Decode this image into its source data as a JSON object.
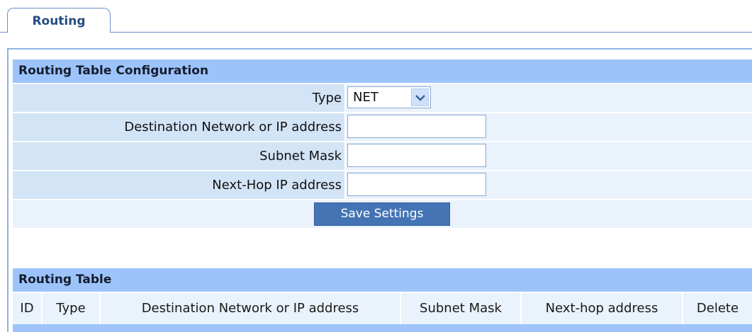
{
  "tab": {
    "label": "Routing"
  },
  "config": {
    "title": "Routing Table Configuration",
    "type_label": "Type",
    "type_value": "NET",
    "destination_label": "Destination Network or IP address",
    "destination_value": "",
    "subnet_label": "Subnet Mask",
    "subnet_value": "",
    "nexthop_label": "Next-Hop IP address",
    "nexthop_value": "",
    "save_label": "Save Settings"
  },
  "table": {
    "title": "Routing Table",
    "columns": [
      "ID",
      "Type",
      "Destination Network or IP address",
      "Subnet Mask",
      "Next-hop address",
      "Delete"
    ],
    "rows": []
  },
  "colors": {
    "header_bg": "#9cc4fb",
    "label_bg": "#d3e4f7",
    "value_bg": "#eaf2fc",
    "button_bg": "#4474b4",
    "tab_text": "#264c82"
  }
}
